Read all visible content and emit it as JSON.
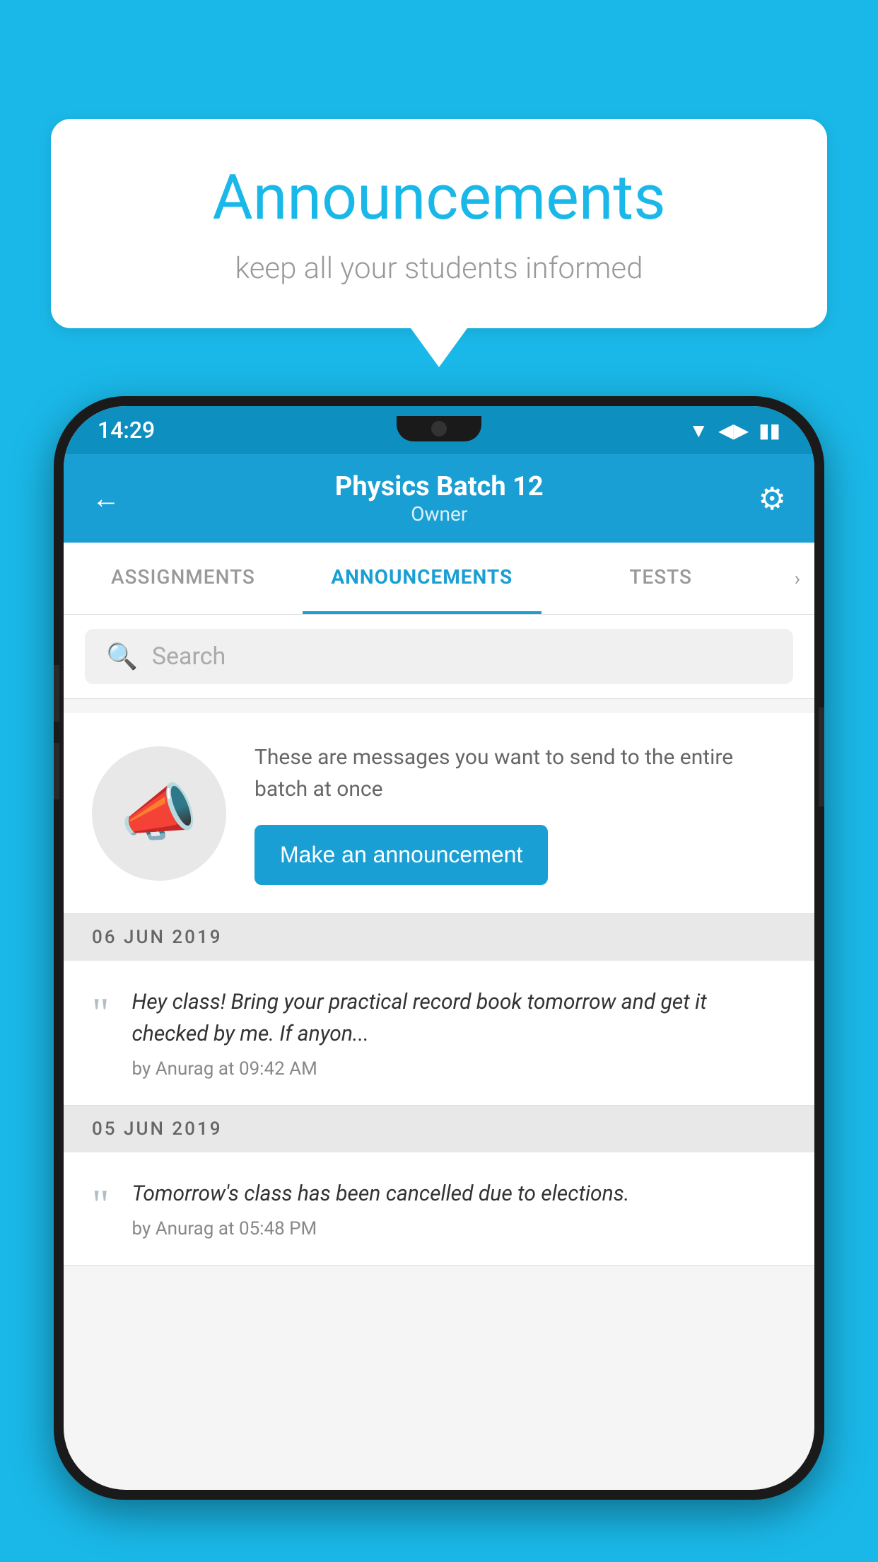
{
  "bubble": {
    "title": "Announcements",
    "subtitle": "keep all your students informed"
  },
  "status_bar": {
    "time": "14:29",
    "wifi_icon": "▼",
    "signal_icon": "▲",
    "battery_icon": "▮"
  },
  "header": {
    "title": "Physics Batch 12",
    "subtitle": "Owner",
    "back_icon": "←",
    "gear_icon": "⚙"
  },
  "tabs": [
    {
      "label": "ASSIGNMENTS",
      "active": false
    },
    {
      "label": "ANNOUNCEMENTS",
      "active": true
    },
    {
      "label": "TESTS",
      "active": false
    }
  ],
  "search": {
    "placeholder": "Search"
  },
  "promo": {
    "description": "These are messages you want to send to the entire batch at once",
    "button_label": "Make an announcement"
  },
  "announcements": [
    {
      "date": "06  JUN  2019",
      "text": "Hey class! Bring your practical record book tomorrow and get it checked by me. If anyon...",
      "author": "by Anurag at 09:42 AM"
    },
    {
      "date": "05  JUN  2019",
      "text": "Tomorrow's class has been cancelled due to elections.",
      "author": "by Anurag at 05:48 PM"
    }
  ],
  "colors": {
    "sky_blue": "#1ab8e8",
    "app_blue": "#1a9fd4",
    "dark": "#1a1a1a",
    "white": "#ffffff"
  }
}
